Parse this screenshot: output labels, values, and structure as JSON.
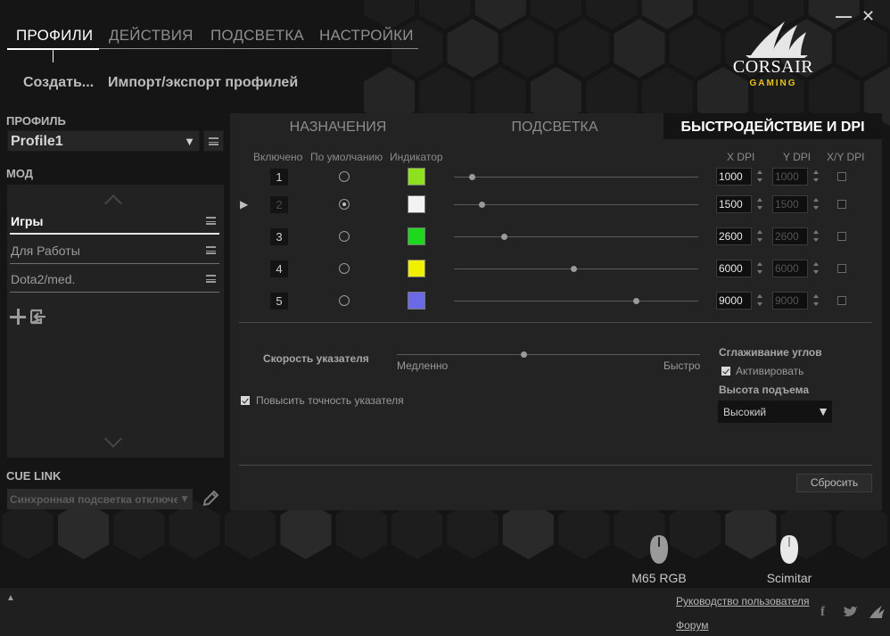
{
  "window": {
    "minimize_label": "—",
    "close_label": "✕"
  },
  "top_tabs": [
    "ПРОФИЛИ",
    "ДЕЙСТВИЯ",
    "ПОДСВЕТКА",
    "НАСТРОЙКИ"
  ],
  "sub_actions": {
    "create": "Создать...",
    "import_export": "Импорт/экспорт профилей"
  },
  "logo": {
    "brand": "CORSAIR",
    "sub": "GAMING"
  },
  "profile": {
    "label": "ПРОФИЛЬ",
    "value": "Profile1"
  },
  "modes": {
    "label": "МОД",
    "items": [
      "Игры",
      "Для Работы",
      "Dota2/med."
    ],
    "active_index": 0
  },
  "cue_link": {
    "label": "CUE LINK",
    "value": "Синхронная подсветка отключе"
  },
  "panel": {
    "tabs": [
      "НАЗНАЧЕНИЯ",
      "ПОДСВЕТКА",
      "БЫСТРОДЕЙСТВИЕ И DPI"
    ],
    "active_tab": 2,
    "headers": {
      "enabled": "Включено",
      "default": "По умолчанию",
      "indicator": "Индикатор",
      "xdpi": "X DPI",
      "ydpi": "Y DPI",
      "xy": "X/Y DPI"
    },
    "dpi_rows": [
      {
        "num": "1",
        "color": "#8fe01e",
        "x": "1000",
        "y": "1000",
        "level": 0.075,
        "default": false,
        "selected": false
      },
      {
        "num": "2",
        "color": "#f2f2f2",
        "x": "1500",
        "y": "1500",
        "level": 0.115,
        "default": true,
        "selected": true
      },
      {
        "num": "3",
        "color": "#1ed81e",
        "x": "2600",
        "y": "2600",
        "level": 0.205,
        "default": false,
        "selected": false
      },
      {
        "num": "4",
        "color": "#f0f000",
        "x": "6000",
        "y": "6000",
        "level": 0.49,
        "default": false,
        "selected": false
      },
      {
        "num": "5",
        "color": "#6a6ae8",
        "x": "9000",
        "y": "9000",
        "level": 0.745,
        "default": false,
        "selected": false
      }
    ],
    "pointer": {
      "speed_label": "Скорость указателя",
      "slow": "Медленно",
      "fast": "Быстро",
      "speed_level": 0.42,
      "precision_label": "Повысить точность указателя",
      "precision_checked": true
    },
    "angle": {
      "label": "Сглаживание углов",
      "activate": "Активировать",
      "checked": true
    },
    "lift": {
      "label": "Высота подъема",
      "value": "Высокий"
    },
    "reset_label": "Сбросить"
  },
  "devices": [
    "M65 RGB",
    "Scimitar"
  ],
  "footer": {
    "manual": "Руководство пользователя",
    "forum": "Форум"
  }
}
